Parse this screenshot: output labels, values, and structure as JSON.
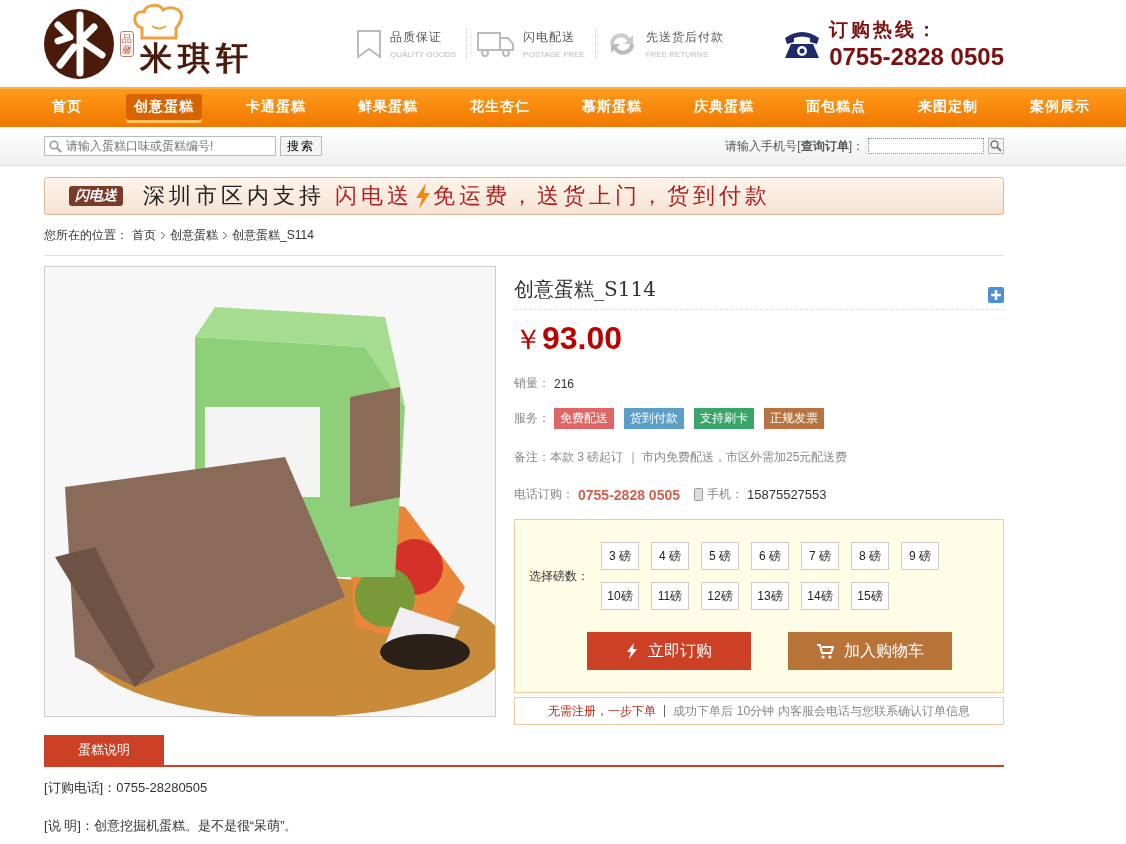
{
  "header": {
    "logo": {
      "seal": "品馨",
      "name": "米琪轩"
    },
    "features": [
      {
        "kind": "quality",
        "title": "品质保证",
        "subtitle": "QUALITY GOODS"
      },
      {
        "kind": "shipping",
        "title": "闪电配送",
        "subtitle": "POSTAGE FREE"
      },
      {
        "kind": "returns",
        "title": "先送货后付款",
        "subtitle": "FREE RETURNS"
      }
    ],
    "hotline": {
      "label": "订购热线：",
      "number": "0755-2828 0505"
    }
  },
  "nav": [
    {
      "label": "首页",
      "selected": false
    },
    {
      "label": "创意蛋糕",
      "selected": true
    },
    {
      "label": "卡通蛋糕",
      "selected": false
    },
    {
      "label": "鲜果蛋糕",
      "selected": false
    },
    {
      "label": "花生杏仁",
      "selected": false
    },
    {
      "label": "慕斯蛋糕",
      "selected": false
    },
    {
      "label": "庆典蛋糕",
      "selected": false
    },
    {
      "label": "面包糕点",
      "selected": false
    },
    {
      "label": "来图定制",
      "selected": false
    },
    {
      "label": "案例展示",
      "selected": false
    }
  ],
  "search": {
    "placeholder": "请输入蛋糕口味或蛋糕编号!",
    "button": "搜索"
  },
  "order_query": {
    "label": "请输入手机号[**查询订单**]："
  },
  "banner": {
    "badge": "闪电送",
    "lead": "深圳市区内支持",
    "highlight": "闪电送",
    "tail": "免运费，送货上门，货到付款"
  },
  "breadcrumb": {
    "label": "您所在的位置：",
    "items": [
      "首页",
      "创意蛋糕",
      "创意蛋糕_S114"
    ]
  },
  "product": {
    "title": "创意蛋糕_S114",
    "currency": "￥",
    "price": "93.00",
    "sales_label": "销量：",
    "sales": "216",
    "services_label": "服务：",
    "services": [
      {
        "label": "免费配送",
        "color": "#e06666"
      },
      {
        "label": "货到付款",
        "color": "#5b9fc8"
      },
      {
        "label": "支持刷卡",
        "color": "#3aa56a"
      },
      {
        "label": "正规发票",
        "color": "#b87340"
      }
    ],
    "note": "备注：本款 3 磅起订 ｜ 市内免费配送，市区外需加25元配送费",
    "phone_label": "电话订购：",
    "phone": "0755-2828 0505",
    "mobile_label": "手机：",
    "mobile": "15875527553"
  },
  "weights": {
    "label": "选择磅数：",
    "options": [
      {
        "label": "3 磅",
        "selected": false
      },
      {
        "label": "4 磅",
        "selected": false
      },
      {
        "label": "5 磅",
        "selected": false
      },
      {
        "label": "6 磅",
        "selected": false
      },
      {
        "label": "7 磅",
        "selected": false
      },
      {
        "label": "8 磅",
        "selected": false
      },
      {
        "label": "9 磅",
        "selected": false
      },
      {
        "label": "10磅",
        "selected": false
      },
      {
        "label": "11磅",
        "selected": false
      },
      {
        "label": "12磅",
        "selected": false
      },
      {
        "label": "13磅",
        "selected": false
      },
      {
        "label": "14磅",
        "selected": false
      },
      {
        "label": "15磅",
        "selected": false
      }
    ]
  },
  "buttons": [
    {
      "kind": "order",
      "label": "立即订购"
    },
    {
      "kind": "cart",
      "label": "加入购物车"
    }
  ],
  "notice": {
    "highlight": "无需注册，一步下单",
    "text": "成功下单后 10分钟 内客服会电话与您联系确认订单信息"
  },
  "tab": {
    "label": "蛋糕说明"
  },
  "description": [
    "[订购电话]：0755-28280505",
    "[说 明]：创意挖掘机蛋糕。是不是很“呆萌”。"
  ]
}
